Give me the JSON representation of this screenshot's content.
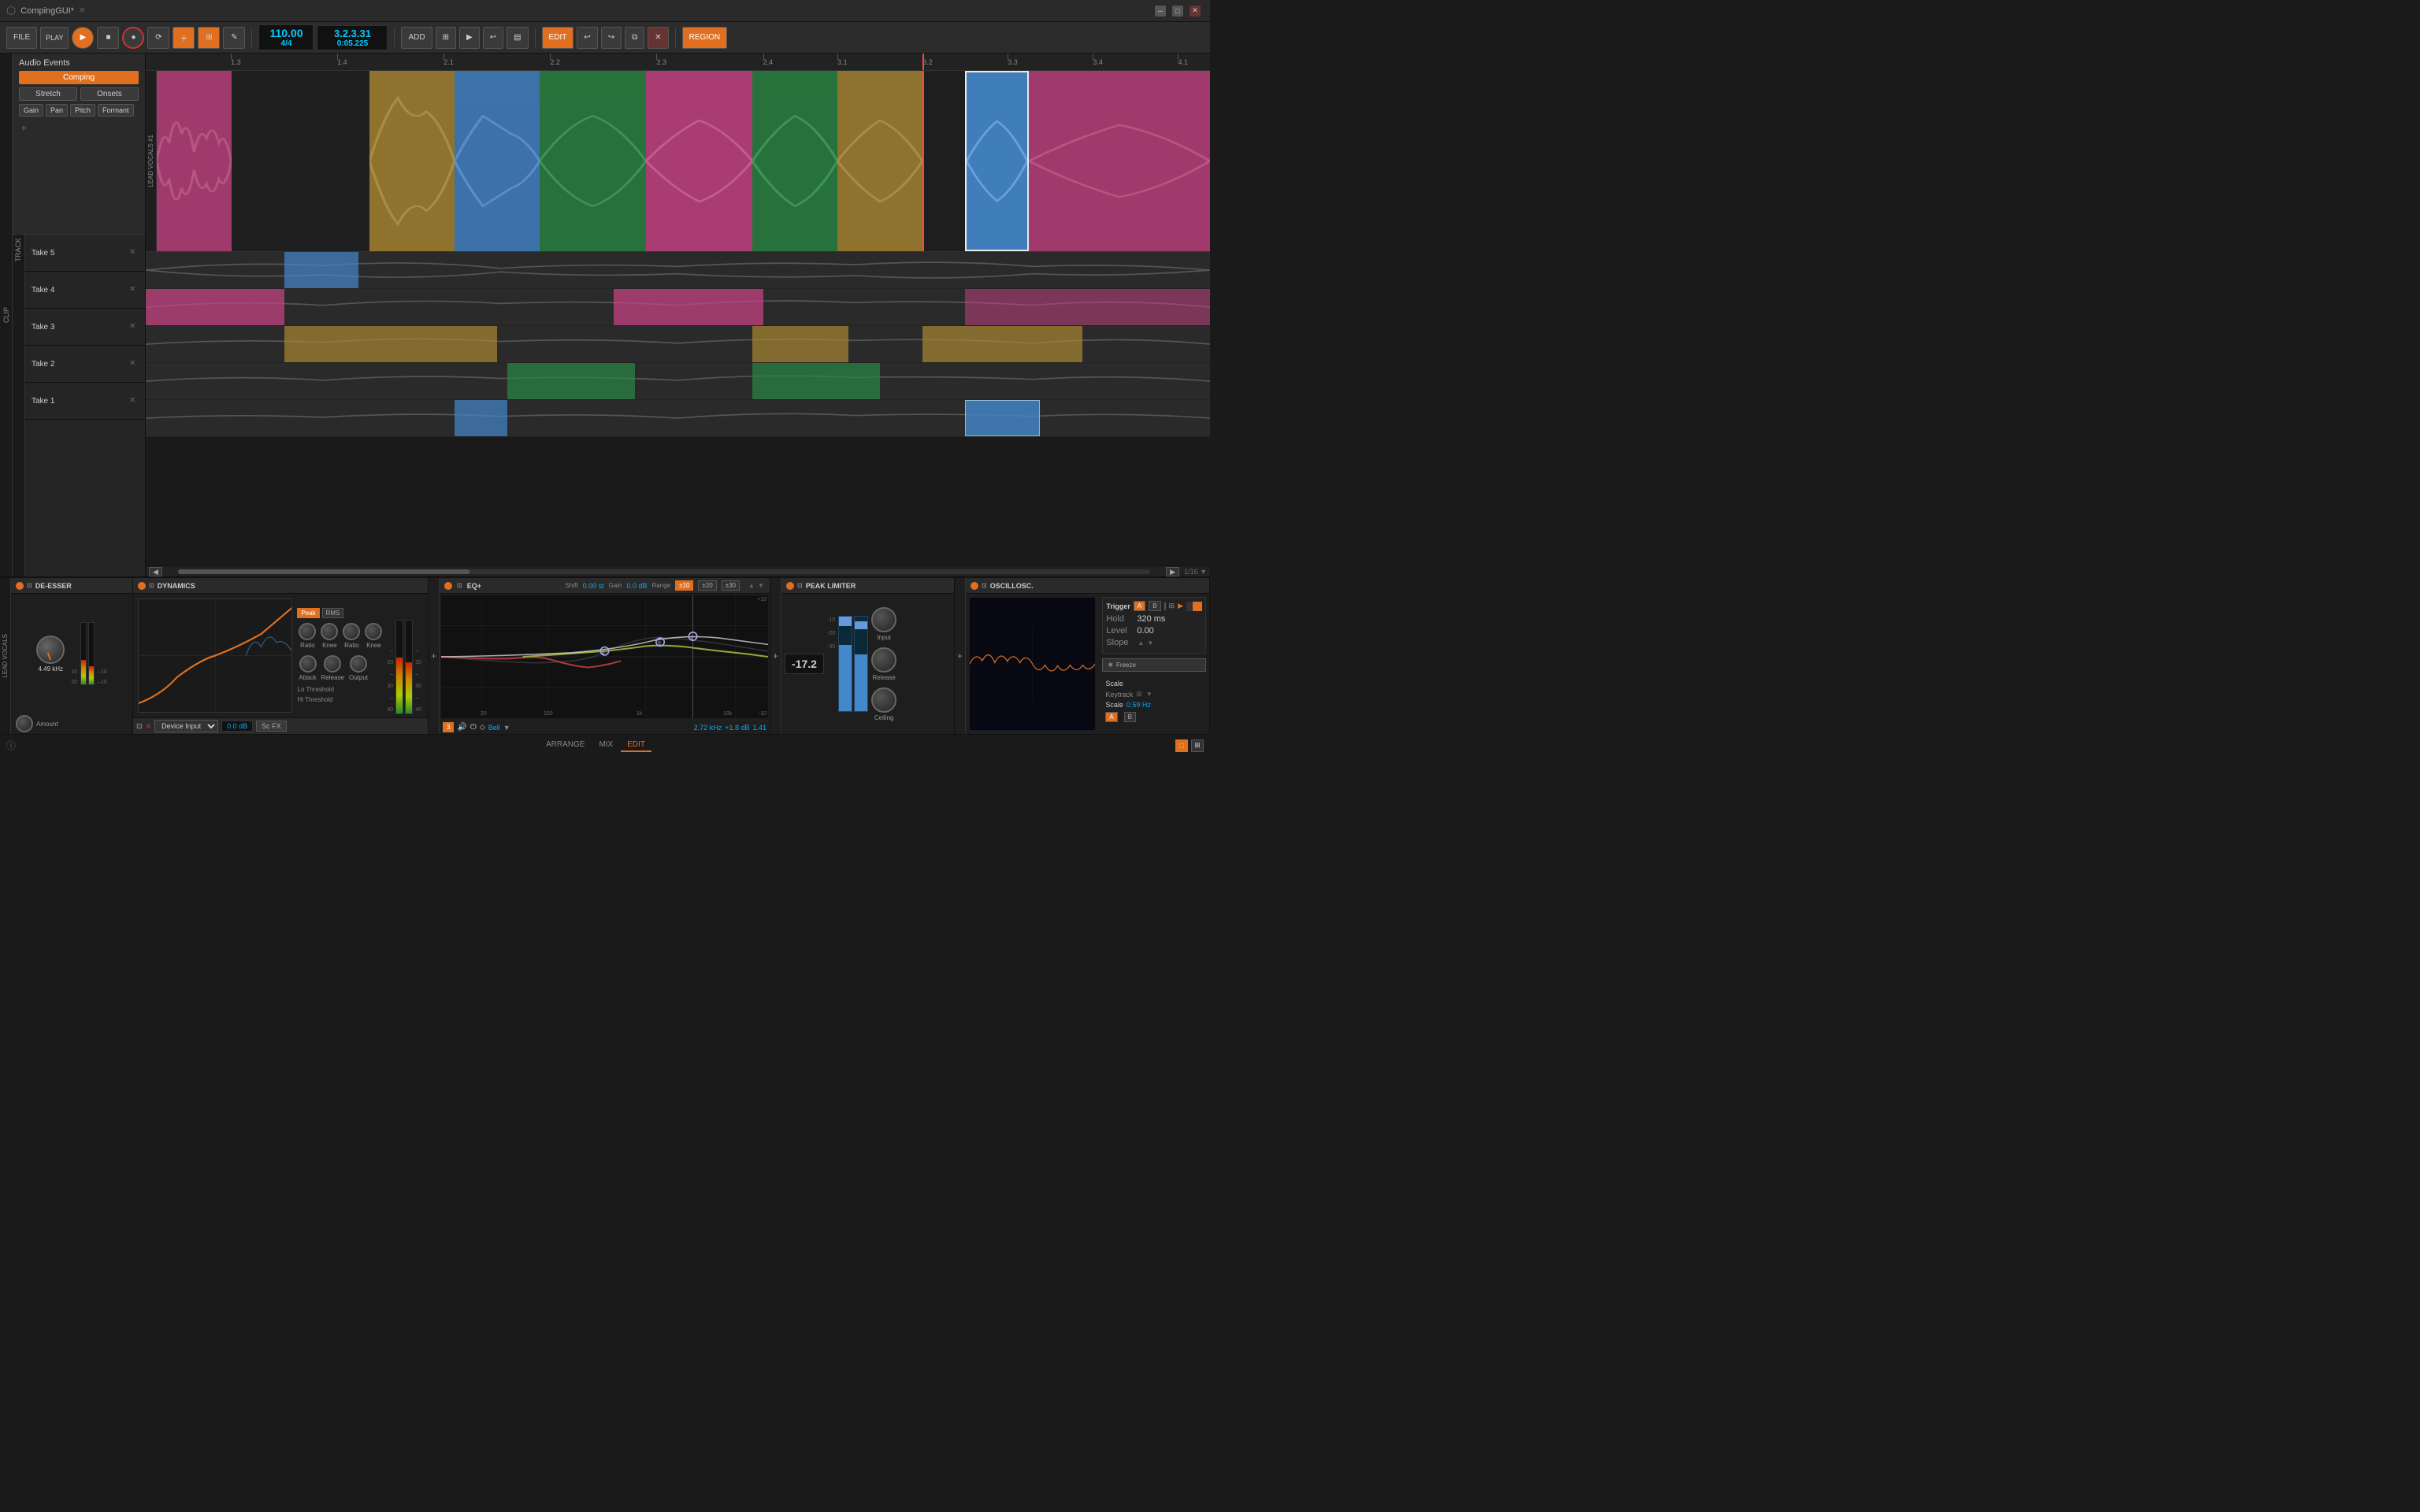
{
  "titlebar": {
    "title": "CompingGUI*",
    "close": "✕",
    "minimize": "—",
    "maximize": "□"
  },
  "transport": {
    "file": "FILE",
    "play": "PLAY",
    "play_icon": "▶",
    "stop_icon": "■",
    "record_icon": "●",
    "loop_icon": "⟳",
    "add_icon": "+",
    "tempo": "110.00",
    "time_sig": "4/4",
    "position": "3.2.3.31",
    "time": "0:05.225",
    "edit_btn": "EDIT",
    "region_btn": "REGION",
    "add_btn": "ADD"
  },
  "ruler": {
    "marks": [
      "1.3",
      "1.4",
      "2.1",
      "2.2",
      "2.3",
      "2.4",
      "3.1",
      "3.2",
      "3.3",
      "3.4",
      "4.1"
    ]
  },
  "panels": {
    "audio_events": "Audio Events",
    "comping": "Comping",
    "stretch": "Stretch",
    "onsets": "Onsets",
    "gain": "Gain",
    "pan": "Pan",
    "pitch": "Pitch",
    "formant": "Formant"
  },
  "tracks": {
    "main": "LEAD VOCALS #1",
    "clip_label": "CLIP",
    "track_label": "TRACK",
    "takes": [
      {
        "name": "Take 5"
      },
      {
        "name": "Take 4"
      },
      {
        "name": "Take 3"
      },
      {
        "name": "Take 2"
      },
      {
        "name": "Take 1"
      }
    ]
  },
  "deesser": {
    "title": "DE-ESSER",
    "freq": "4.49 kHz",
    "amount_label": "Amount",
    "db_10": "10",
    "db_20": "20"
  },
  "dynamics": {
    "title": "DYNAMICS",
    "lo_threshold": "Lo Threshold",
    "hi_threshold": "Hi Threshold",
    "ratio1_label": "Ratio",
    "knee1_label": "Knee",
    "ratio2_label": "Ratio",
    "knee2_label": "Knee",
    "attack_label": "Attack",
    "release_label": "Release",
    "output_label": "Output",
    "peak_btn": "Peak",
    "rms_btn": "RMS",
    "db_readout": "0.0 dB",
    "device_input": "Device Input"
  },
  "eq": {
    "title": "EQ+",
    "shift_label": "Shift",
    "shift_value": "0.00 st",
    "gain_label": "Gain",
    "gain_value": "0.0 dB",
    "range_label": "Range",
    "range_10": "±10",
    "range_20": "±20",
    "range_30": "±30",
    "band_label": "3",
    "bell_label": "Bell",
    "freq_value": "2.72 kHz",
    "gain_band": "+1.8 dB",
    "q_value": "1.41",
    "grid_labels": [
      "20",
      "100",
      "1k",
      "10k"
    ]
  },
  "limiter": {
    "title": "PEAK LIMITER",
    "value": "-17.2",
    "input_label": "Input",
    "release_label": "Release",
    "ceiling_label": "Ceiling"
  },
  "oscilloscope": {
    "title": "OSCILLOSC.",
    "trigger_label": "Trigger",
    "a_btn": "A",
    "b_btn": "B",
    "hold_label": "Hold",
    "hold_value": "320 ms",
    "level_label": "Level",
    "level_value": "0.00",
    "slope_label": "Slope",
    "freeze_btn": "Freeze",
    "scale_label": "Scale",
    "keytrack_label": "Keytrack",
    "scale_hz": "0.59 Hz",
    "a_label": "A",
    "b_label": "B"
  },
  "bottom_tabs": {
    "arrange": "ARRANGE",
    "mix": "MIX",
    "edit": "EDIT"
  },
  "colors": {
    "orange": "#e07020",
    "blue": "#00aaff",
    "green": "#2a8a2a",
    "pink": "#cc4488",
    "gold": "#aa8833",
    "teal": "#2a8888",
    "purple": "#8844aa",
    "bg_dark": "#1a1a1a",
    "bg_mid": "#252525",
    "bg_panel": "#2a2a2a",
    "text_primary": "#cccccc",
    "text_dim": "#888888",
    "accent": "#e07020"
  }
}
